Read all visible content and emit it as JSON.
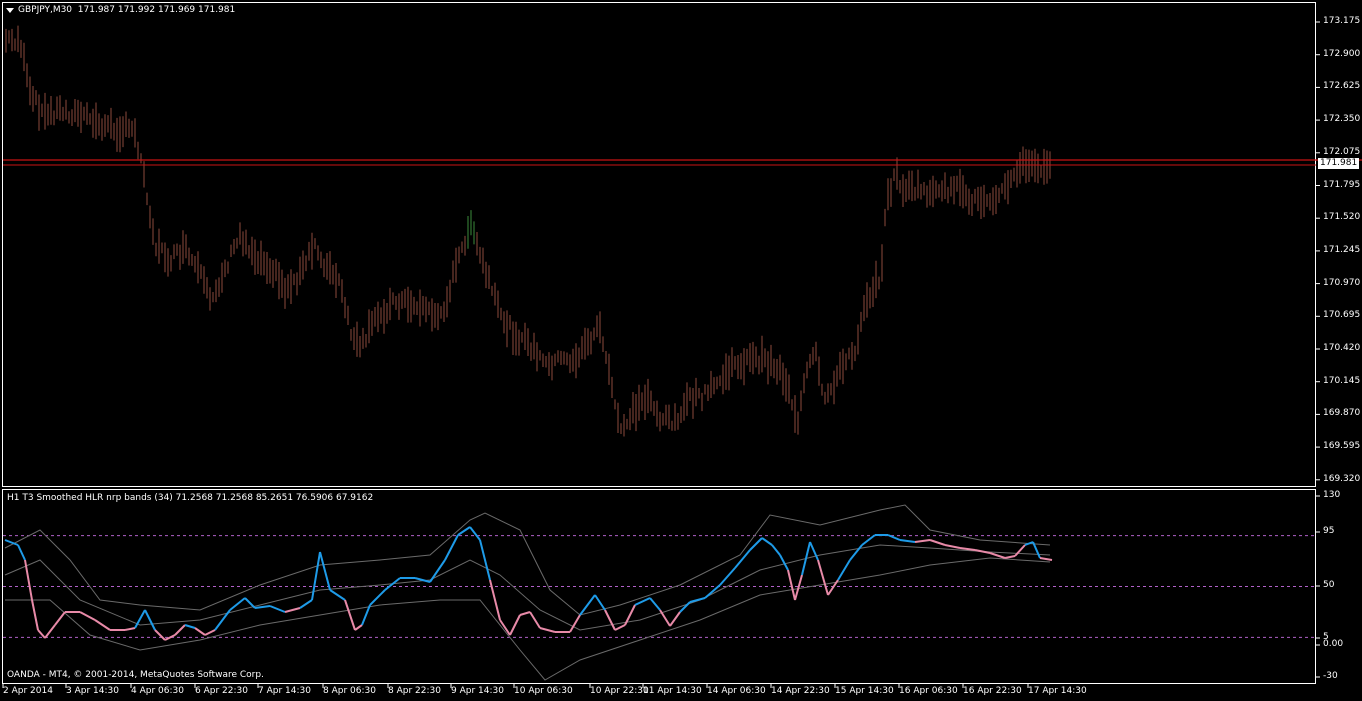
{
  "main_header": {
    "symbol": "GBPJPY,M30",
    "ohlc": "171.987 171.992 171.969 171.981"
  },
  "price_axis": {
    "labels": [
      "173.175",
      "172.900",
      "172.625",
      "172.350",
      "172.075",
      "171.795",
      "171.520",
      "171.245",
      "170.970",
      "170.695",
      "170.420",
      "170.145",
      "169.870",
      "169.595",
      "169.320"
    ],
    "current_price": "171.981",
    "current_price_color": "#ff0000"
  },
  "indicator": {
    "header": "H1  T3 Smoothed HLR nrp bands (34) 71.2568 71.2568 85.2651 76.5906 67.9162",
    "axis_labels": [
      "130",
      "95",
      "50",
      "5",
      "0.00",
      "-30"
    ],
    "levels": [
      95,
      50,
      5
    ],
    "up_color": "#1e9be8",
    "down_color": "#e88aa8",
    "band_color": "#6a6a6a",
    "level_color": "#b060c8"
  },
  "copyright": "OANDA - MT4, © 2001-2014, MetaQuotes Software Corp.",
  "time_axis": [
    "2 Apr 2014",
    "3 Apr 14:30",
    "4 Apr 06:30",
    "6 Apr 22:30",
    "7 Apr 14:30",
    "8 Apr 06:30",
    "8 Apr 22:30",
    "9 Apr 14:30",
    "10 Apr 06:30",
    "10 Apr 22:30",
    "11 Apr 14:30",
    "14 Apr 06:30",
    "14 Apr 22:30",
    "15 Apr 14:30",
    "16 Apr 06:30",
    "16 Apr 22:30",
    "17 Apr 14:30"
  ],
  "colors": {
    "bar": "#8b4a3c",
    "bar_up_highlight": "#3c8b3c",
    "hline": "#c81414",
    "frame": "#ffffff"
  }
}
